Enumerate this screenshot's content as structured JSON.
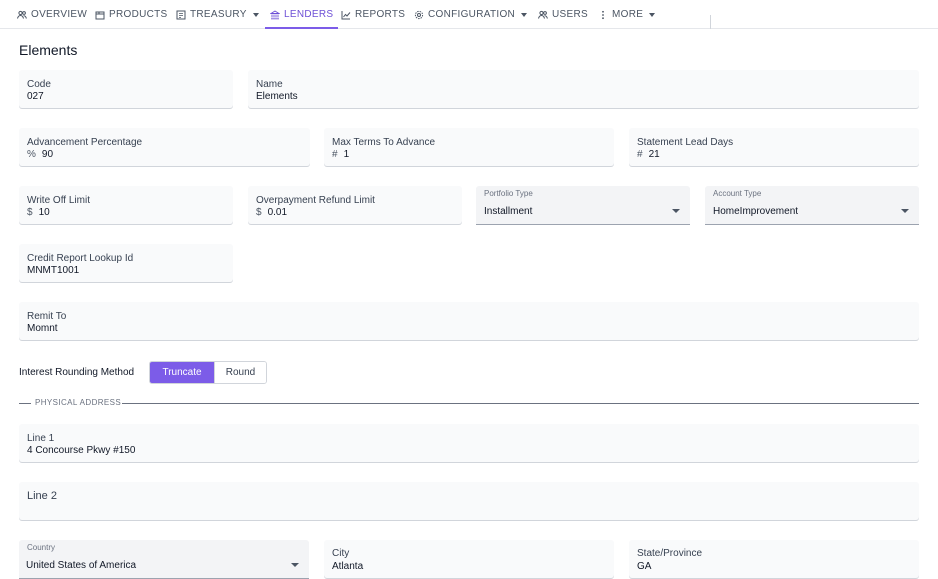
{
  "nav": {
    "items": [
      {
        "label": "OVERVIEW",
        "icon": "users-icon"
      },
      {
        "label": "PRODUCTS",
        "icon": "box-icon"
      },
      {
        "label": "TREASURY",
        "icon": "ledger-icon",
        "dropdown": true
      },
      {
        "label": "LENDERS",
        "icon": "bank-icon",
        "active": true
      },
      {
        "label": "REPORTS",
        "icon": "chart-line-icon"
      },
      {
        "label": "CONFIGURATION",
        "icon": "gear-icon",
        "dropdown": true
      },
      {
        "label": "USERS",
        "icon": "users-icon"
      },
      {
        "label": "MORE",
        "icon": "dots-vertical-icon",
        "dropdown": true
      }
    ]
  },
  "page": {
    "title": "Elements"
  },
  "form": {
    "code": {
      "label": "Code",
      "value": "027"
    },
    "name": {
      "label": "Name",
      "value": "Elements"
    },
    "advancement_percentage": {
      "label": "Advancement Percentage",
      "prefix": "%",
      "value": "90"
    },
    "max_terms_to_advance": {
      "label": "Max Terms To Advance",
      "prefix": "#",
      "value": "1"
    },
    "statement_lead_days": {
      "label": "Statement Lead Days",
      "prefix": "#",
      "value": "21"
    },
    "write_off_limit": {
      "label": "Write Off Limit",
      "prefix": "$",
      "value": "10"
    },
    "overpayment_refund_limit": {
      "label": "Overpayment Refund Limit",
      "prefix": "$",
      "value": "0.01"
    },
    "portfolio_type": {
      "label": "Portfolio Type",
      "value": "Installment"
    },
    "account_type": {
      "label": "Account Type",
      "value": "HomeImprovement"
    },
    "credit_report_lookup_id": {
      "label": "Credit Report Lookup Id",
      "value": "MNMT1001"
    },
    "remit_to": {
      "label": "Remit To",
      "value": "Momnt"
    },
    "interest_rounding": {
      "label": "Interest Rounding Method",
      "options": [
        "Truncate",
        "Round"
      ],
      "selected": "Truncate"
    }
  },
  "address": {
    "section_label": "PHYSICAL ADDRESS",
    "line1": {
      "label": "Line 1",
      "value": "4 Concourse Pkwy #150"
    },
    "line2": {
      "label": "Line 2",
      "value": ""
    },
    "country": {
      "label": "Country",
      "value": "United States of America"
    },
    "city": {
      "label": "City",
      "value": "Atlanta"
    },
    "state": {
      "label": "State/Province",
      "value": "GA"
    }
  },
  "colors": {
    "accent": "#7c5ce8",
    "field_bg": "#f9fafb",
    "select_bg": "#f3f4f6"
  }
}
